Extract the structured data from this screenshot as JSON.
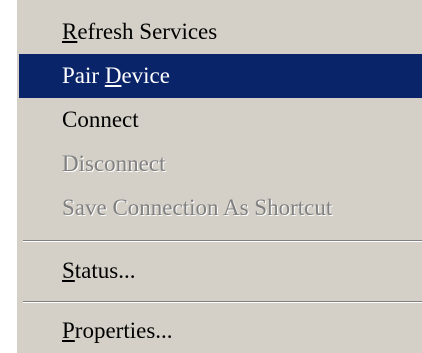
{
  "menu": {
    "items": [
      {
        "pre": "",
        "mnemonic": "R",
        "post": "efresh Services",
        "state": "normal",
        "submenu": false
      },
      {
        "pre": "Pair ",
        "mnemonic": "D",
        "post": "evice",
        "state": "selected",
        "submenu": false
      },
      {
        "pre": "Connect",
        "mnemonic": "",
        "post": "",
        "state": "normal",
        "submenu": true
      },
      {
        "pre": "Disconnect",
        "mnemonic": "",
        "post": "",
        "state": "disabled",
        "submenu": true
      },
      {
        "pre": "Save Connection As Shortcut",
        "mnemonic": "",
        "post": "",
        "state": "disabled",
        "submenu": true
      },
      {
        "pre": "",
        "mnemonic": "S",
        "post": "tatus...",
        "state": "normal",
        "submenu": false
      },
      {
        "pre": "",
        "mnemonic": "P",
        "post": "roperties...",
        "state": "normal",
        "submenu": false
      }
    ]
  },
  "colors": {
    "menu_background": "#d4d0c8",
    "selection_background": "#0a246a",
    "selection_text": "#ffffff",
    "disabled_text": "#808080"
  }
}
